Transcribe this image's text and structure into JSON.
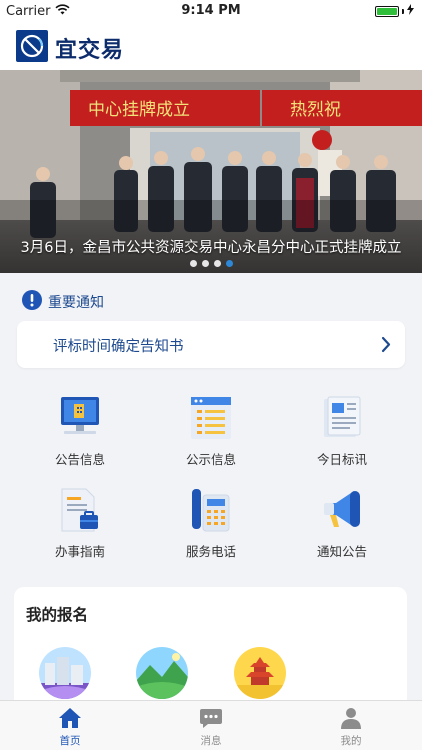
{
  "status_bar": {
    "carrier": "Carrier",
    "time": "9:14 PM",
    "battery_percent": 100
  },
  "header": {
    "app_name": "宜交易",
    "logo_icon": "app-logo"
  },
  "banner": {
    "caption": "3月6日，金昌市公共资源交易中心永昌分中心正式挂牌成立",
    "sign_left": "中心挂牌成立",
    "sign_right": "热烈祝",
    "slide_count": 4,
    "active_slide": 4
  },
  "notice": {
    "section_title": "重要通知",
    "item_text": "评标时间确定告知书"
  },
  "features": [
    {
      "label": "公告信息",
      "icon": "monitor-icon"
    },
    {
      "label": "公示信息",
      "icon": "list-board-icon"
    },
    {
      "label": "今日标讯",
      "icon": "newspaper-icon"
    },
    {
      "label": "办事指南",
      "icon": "guide-document-icon"
    },
    {
      "label": "服务电话",
      "icon": "telephone-icon"
    },
    {
      "label": "通知公告",
      "icon": "megaphone-icon"
    }
  ],
  "signup": {
    "title": "我的报名"
  },
  "tabbar": {
    "tabs": [
      {
        "label": "首页",
        "icon": "home-icon",
        "active": true
      },
      {
        "label": "消息",
        "icon": "message-icon",
        "active": false
      },
      {
        "label": "我的",
        "icon": "profile-icon",
        "active": false
      }
    ]
  },
  "colors": {
    "primary": "#1d4a8f",
    "tab_active": "#1f56b5",
    "tab_inactive": "#8c8c8c",
    "background": "#f2f3f7"
  }
}
